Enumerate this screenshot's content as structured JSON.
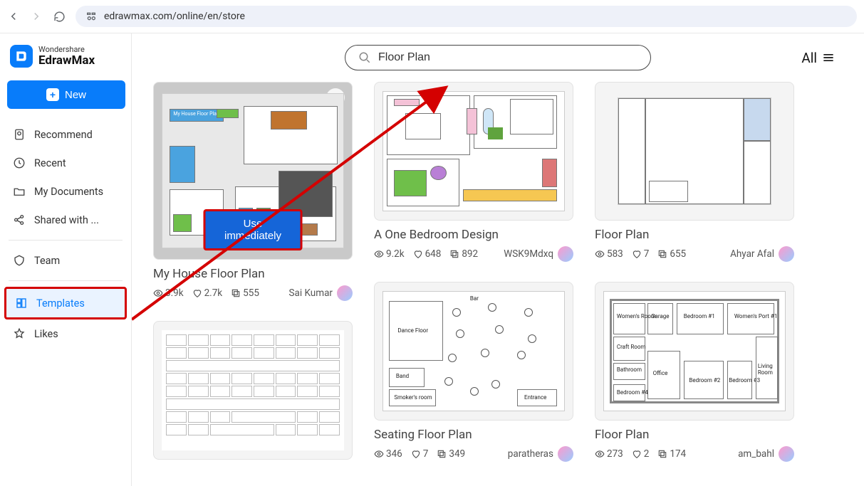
{
  "browser": {
    "url": "edrawmax.com/online/en/store"
  },
  "logo": {
    "brand_top": "Wondershare",
    "brand_bottom": "EdrawMax"
  },
  "new_button": "New",
  "sidebar": {
    "items": [
      {
        "label": "Recommend"
      },
      {
        "label": "Recent"
      },
      {
        "label": "My Documents"
      },
      {
        "label": "Shared with ..."
      },
      {
        "label": "Team"
      },
      {
        "label": "Templates"
      },
      {
        "label": "Likes"
      }
    ]
  },
  "search": {
    "value": "Floor Plan"
  },
  "filter": {
    "label": "All"
  },
  "use_immediately": "Use immediately",
  "templates": [
    {
      "title": "My House Floor Plan",
      "views": "3.9k",
      "likes": "2.7k",
      "copies": "555",
      "author": "Sai Kumar"
    },
    {
      "title": "A One Bedroom Design",
      "views": "9.2k",
      "likes": "648",
      "copies": "892",
      "author": "WSK9Mdxq"
    },
    {
      "title": "Floor Plan",
      "views": "583",
      "likes": "7",
      "copies": "655",
      "author": "Ahyar Afal"
    },
    {
      "title": "Seating Floor Plan",
      "views": "346",
      "likes": "7",
      "copies": "349",
      "author": "paratheras"
    },
    {
      "title": "Floor Plan",
      "views": "273",
      "likes": "2",
      "copies": "174",
      "author": "am_bahl"
    }
  ]
}
